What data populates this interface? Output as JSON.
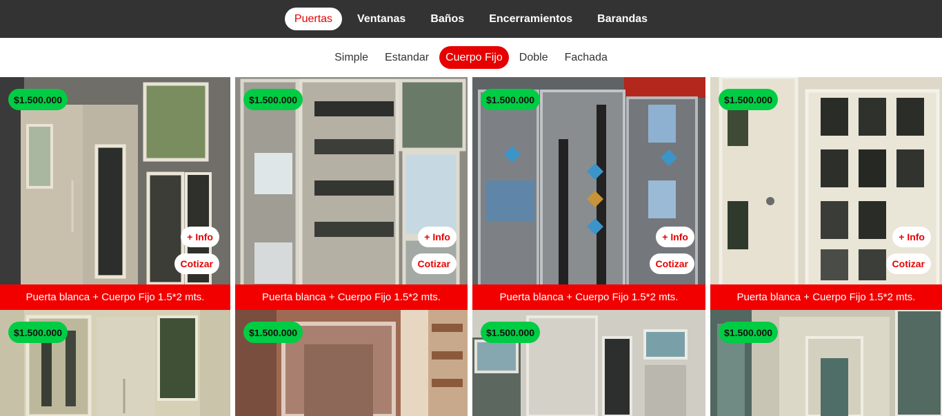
{
  "top_nav": [
    {
      "label": "Puertas",
      "active": true
    },
    {
      "label": "Ventanas",
      "active": false
    },
    {
      "label": "Baños",
      "active": false
    },
    {
      "label": "Encerramientos",
      "active": false
    },
    {
      "label": "Barandas",
      "active": false
    }
  ],
  "sub_nav": [
    {
      "label": "Simple",
      "active": false
    },
    {
      "label": "Estandar",
      "active": false
    },
    {
      "label": "Cuerpo Fijo",
      "active": true
    },
    {
      "label": "Doble",
      "active": false
    },
    {
      "label": "Fachada",
      "active": false
    }
  ],
  "products": [
    {
      "price": "$1.500.000",
      "info_label": "+ Info",
      "quote_label": "Cotizar",
      "title": "Puerta blanca + Cuerpo Fijo 1.5*2 mts."
    },
    {
      "price": "$1.500.000",
      "info_label": "+ Info",
      "quote_label": "Cotizar",
      "title": "Puerta blanca + Cuerpo Fijo 1.5*2 mts."
    },
    {
      "price": "$1.500.000",
      "info_label": "+ Info",
      "quote_label": "Cotizar",
      "title": "Puerta blanca + Cuerpo Fijo 1.5*2 mts."
    },
    {
      "price": "$1.500.000",
      "info_label": "+ Info",
      "quote_label": "Cotizar",
      "title": "Puerta blanca + Cuerpo Fijo 1.5*2 mts."
    },
    {
      "price": "$1.500.000"
    },
    {
      "price": "$1.500.000"
    },
    {
      "price": "$1.500.000"
    },
    {
      "price": "$1.500.000"
    }
  ],
  "colors": {
    "topbar_bg": "#333333",
    "accent_red": "#e60000",
    "price_badge_green": "#00cc44"
  }
}
